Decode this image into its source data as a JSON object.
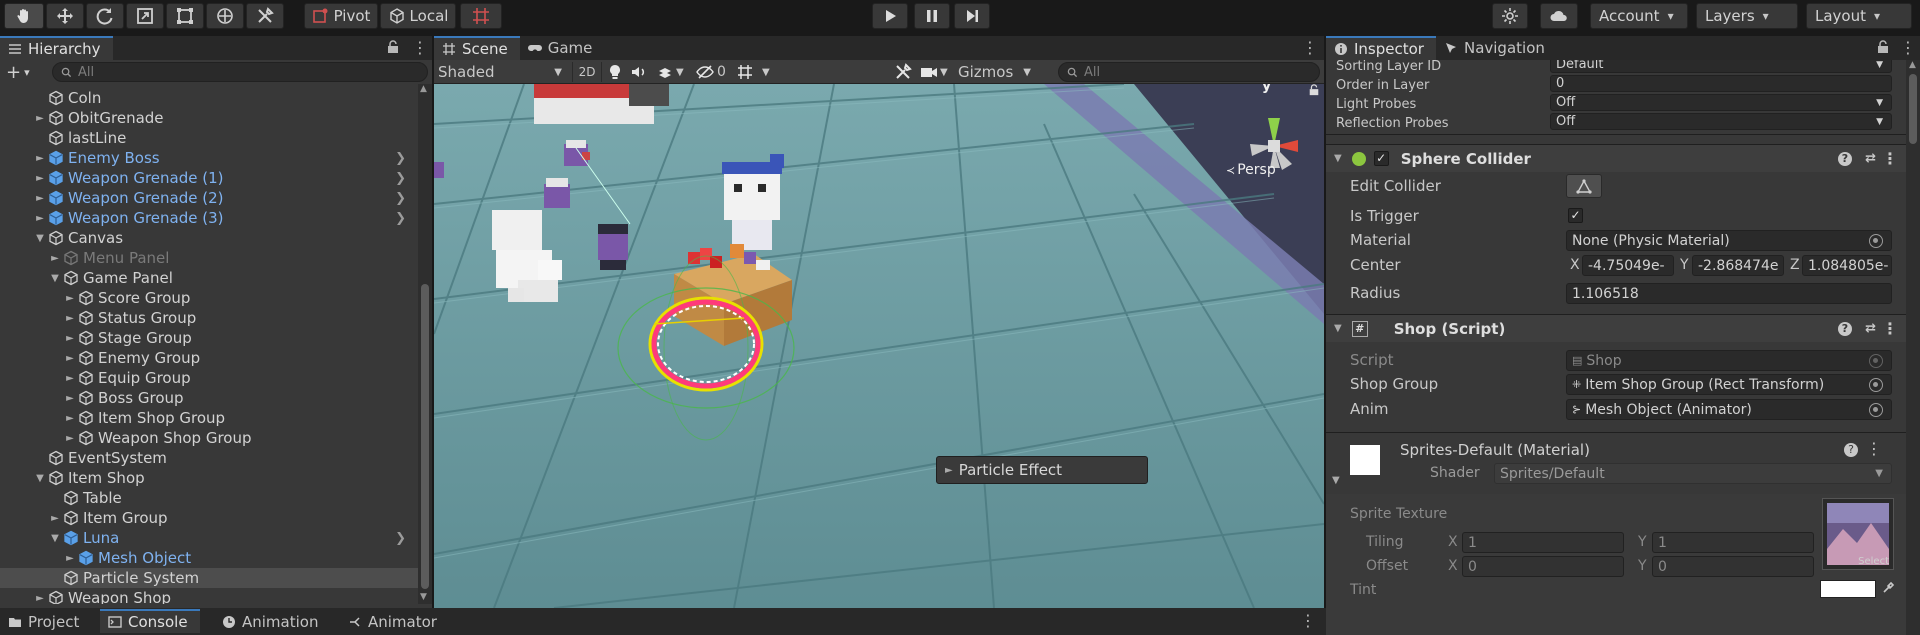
{
  "toolbar": {
    "pivot_label": "Pivot",
    "local_label": "Local",
    "account_label": "Account",
    "layers_label": "Layers",
    "layout_label": "Layout"
  },
  "hierarchy": {
    "tab_label": "Hierarchy",
    "search_placeholder": "All",
    "rows": [
      {
        "label": "Coln",
        "indent": 3,
        "arrow": "",
        "kind": "normal"
      },
      {
        "label": "ObitGrenade",
        "indent": 3,
        "arrow": "►",
        "kind": "normal"
      },
      {
        "label": "lastLine",
        "indent": 3,
        "arrow": "",
        "kind": "normal"
      },
      {
        "label": "Enemy Boss",
        "indent": 3,
        "arrow": "►",
        "kind": "prefab",
        "go": true
      },
      {
        "label": "Weapon Grenade (1)",
        "indent": 3,
        "arrow": "►",
        "kind": "prefab",
        "go": true
      },
      {
        "label": "Weapon Grenade (2)",
        "indent": 3,
        "arrow": "►",
        "kind": "prefab",
        "go": true
      },
      {
        "label": "Weapon Grenade (3)",
        "indent": 3,
        "arrow": "►",
        "kind": "prefab",
        "go": true
      },
      {
        "label": "Canvas",
        "indent": 3,
        "arrow": "▼",
        "kind": "normal"
      },
      {
        "label": "Menu Panel",
        "indent": 4,
        "arrow": "►",
        "kind": "disabled"
      },
      {
        "label": "Game Panel",
        "indent": 4,
        "arrow": "▼",
        "kind": "normal"
      },
      {
        "label": "Score Group",
        "indent": 5,
        "arrow": "►",
        "kind": "normal"
      },
      {
        "label": "Status Group",
        "indent": 5,
        "arrow": "►",
        "kind": "normal"
      },
      {
        "label": "Stage Group",
        "indent": 5,
        "arrow": "►",
        "kind": "normal"
      },
      {
        "label": "Enemy Group",
        "indent": 5,
        "arrow": "►",
        "kind": "normal"
      },
      {
        "label": "Equip Group",
        "indent": 5,
        "arrow": "►",
        "kind": "normal"
      },
      {
        "label": "Boss Group",
        "indent": 5,
        "arrow": "►",
        "kind": "normal"
      },
      {
        "label": "Item Shop Group",
        "indent": 5,
        "arrow": "►",
        "kind": "normal"
      },
      {
        "label": "Weapon Shop Group",
        "indent": 5,
        "arrow": "►",
        "kind": "normal"
      },
      {
        "label": "EventSystem",
        "indent": 3,
        "arrow": "",
        "kind": "normal"
      },
      {
        "label": "Item Shop",
        "indent": 3,
        "arrow": "▼",
        "kind": "normal"
      },
      {
        "label": "Table",
        "indent": 4,
        "arrow": "",
        "kind": "normal"
      },
      {
        "label": "Item Group",
        "indent": 4,
        "arrow": "►",
        "kind": "normal"
      },
      {
        "label": "Luna",
        "indent": 4,
        "arrow": "▼",
        "kind": "prefab",
        "go": true
      },
      {
        "label": "Mesh Object",
        "indent": 5,
        "arrow": "►",
        "kind": "prefab"
      },
      {
        "label": "Particle System",
        "indent": 4,
        "arrow": "",
        "kind": "selected"
      },
      {
        "label": "Weapon Shop",
        "indent": 3,
        "arrow": "►",
        "kind": "normal"
      }
    ]
  },
  "scene": {
    "tab_scene": "Scene",
    "tab_game": "Game",
    "shading_mode": "Shaded",
    "mode_2d": "2D",
    "hidden_count": "0",
    "gizmos_label": "Gizmos",
    "search_placeholder": "All",
    "persp_label": "Persp",
    "gizmo_axis_y": "y",
    "particle_effect_label": "Particle Effect"
  },
  "inspector": {
    "tab_inspector": "Inspector",
    "tab_navigation": "Navigation",
    "top_rows": [
      {
        "label": "Sorting Layer ID",
        "value": "Default"
      },
      {
        "label": "Order in Layer",
        "value": "0"
      },
      {
        "label": "Light Probes",
        "value": "Off"
      },
      {
        "label": "Reflection Probes",
        "value": "Off"
      }
    ],
    "sphere_collider": {
      "title": "Sphere Collider",
      "edit_collider": "Edit Collider",
      "is_trigger": "Is Trigger",
      "material_label": "Material",
      "material_value": "None (Physic Material)",
      "center_label": "Center",
      "center_x": "-4.75049e-",
      "center_y": "-2.868474e",
      "center_z": "1.084805e-",
      "radius_label": "Radius",
      "radius_value": "1.106518"
    },
    "shop_script": {
      "title": "Shop (Script)",
      "script_label": "Script",
      "script_value": "Shop",
      "shop_group_label": "Shop Group",
      "shop_group_value": "Item Shop Group (Rect Transform)",
      "anim_label": "Anim",
      "anim_value": "Mesh Object (Animator)"
    },
    "material": {
      "title": "Sprites-Default (Material)",
      "shader_label": "Shader",
      "shader_value": "Sprites/Default",
      "sprite_texture": "Sprite Texture",
      "tiling_label": "Tiling",
      "tiling_x": "1",
      "tiling_y": "1",
      "offset_label": "Offset",
      "offset_x": "0",
      "offset_y": "0",
      "tint_label": "Tint",
      "select_label": "Select",
      "axis_x": "X",
      "axis_y": "Y",
      "axis_z": "Z"
    }
  },
  "bottom_tabs": [
    "Project",
    "Console",
    "Animation",
    "Animator"
  ]
}
